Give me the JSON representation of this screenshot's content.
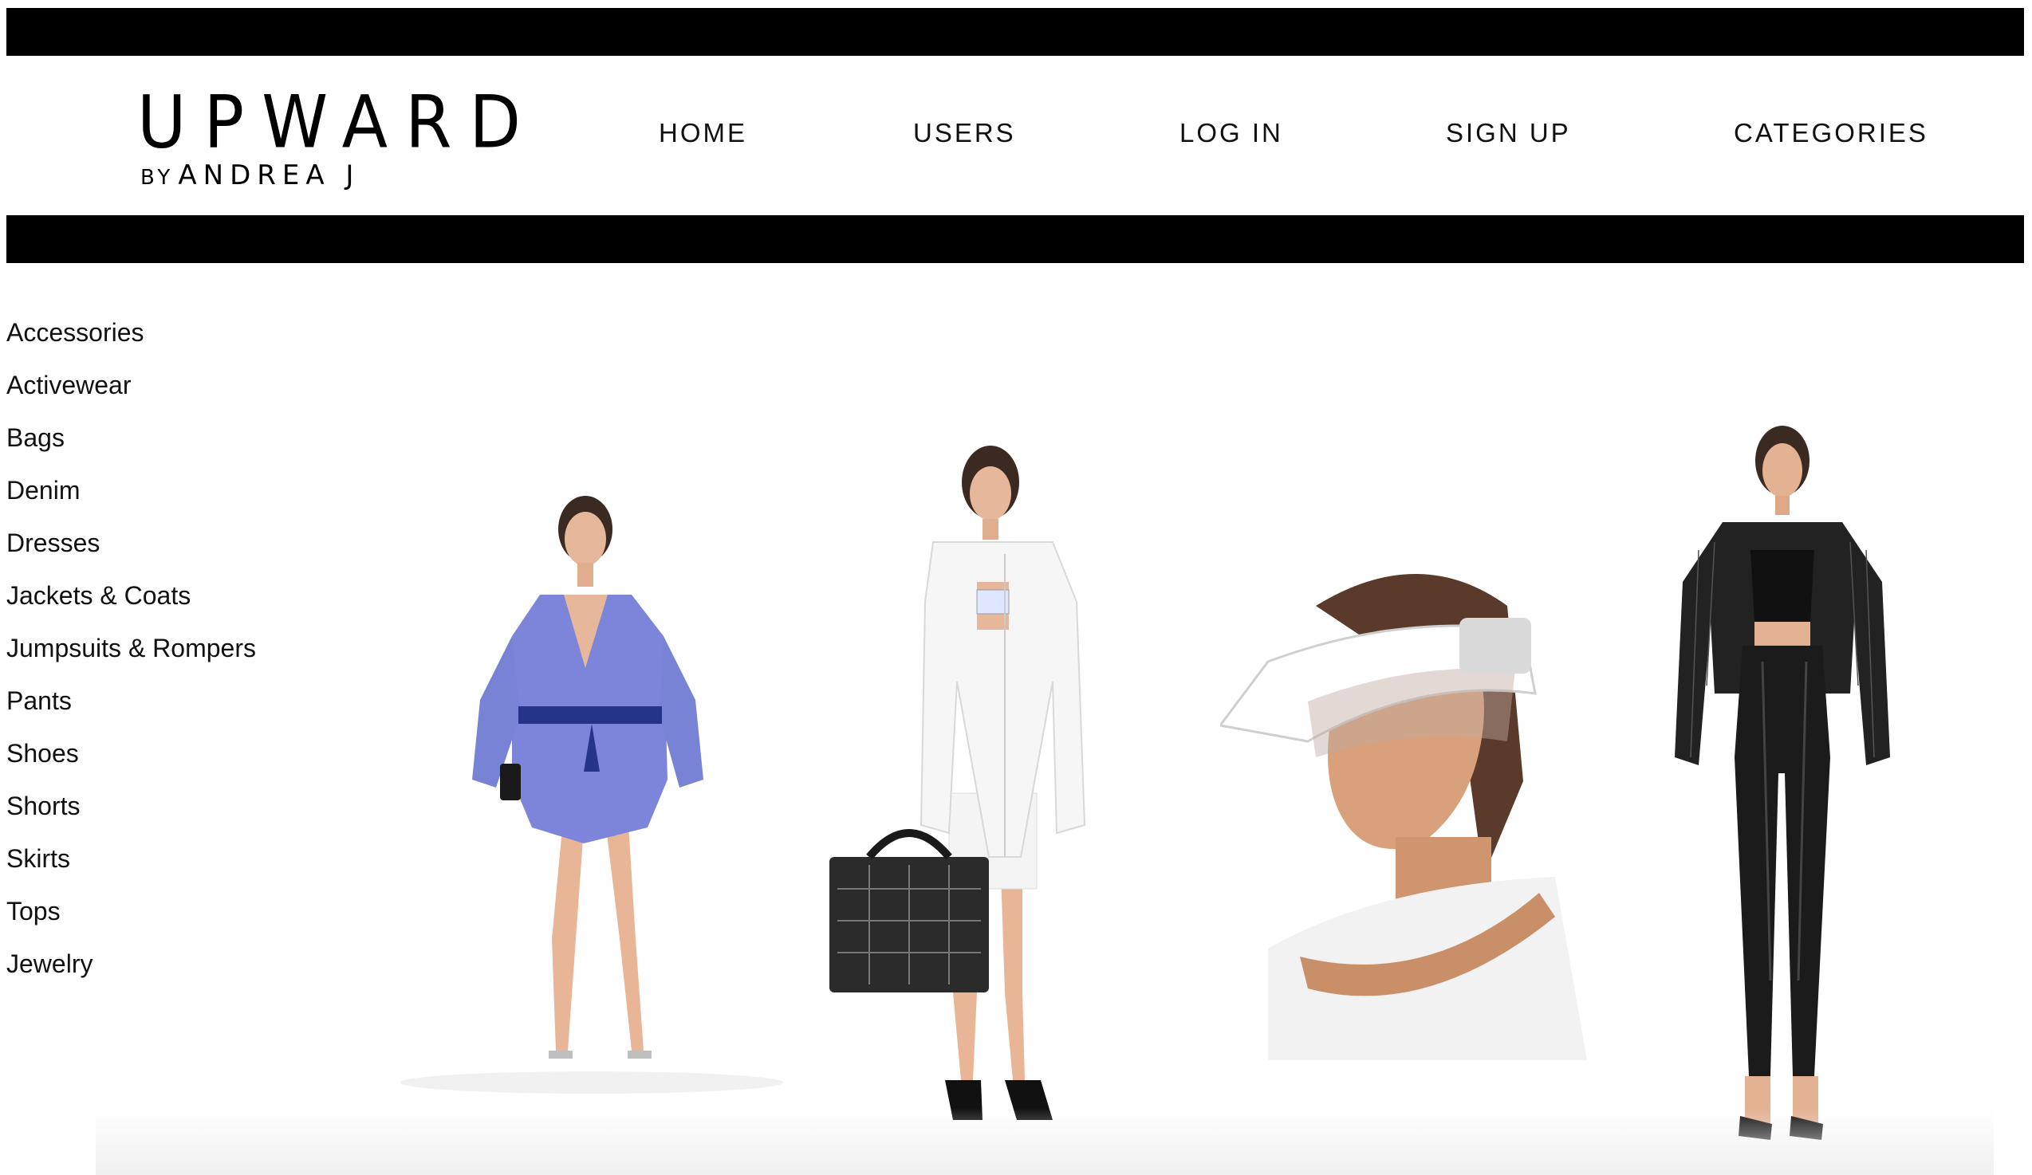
{
  "brand": {
    "name": "UPWARD",
    "by": "BY",
    "designer": "ANDREA J"
  },
  "nav": {
    "home": "HOME",
    "users": "USERS",
    "login": "LOG IN",
    "signup": "SIGN UP",
    "categories": "CATEGORIES"
  },
  "sidebar": {
    "items": [
      {
        "label": "Accessories"
      },
      {
        "label": "Activewear"
      },
      {
        "label": "Bags"
      },
      {
        "label": "Denim"
      },
      {
        "label": "Dresses"
      },
      {
        "label": "Jackets & Coats"
      },
      {
        "label": "Jumpsuits & Rompers"
      },
      {
        "label": "Pants"
      },
      {
        "label": "Shoes"
      },
      {
        "label": "Shorts"
      },
      {
        "label": "Skirts"
      },
      {
        "label": "Tops"
      },
      {
        "label": "Jewelry"
      }
    ]
  },
  "products": [
    {
      "image": "model-blue-sequin-wrap-dress"
    },
    {
      "image": "model-white-jacket-shorts-with-bag"
    },
    {
      "image": "model-white-visor"
    },
    {
      "image": "model-black-blazer-leather-pants"
    }
  ],
  "colors": {
    "bar": "#000000",
    "background": "#ffffff",
    "text": "#111111"
  }
}
